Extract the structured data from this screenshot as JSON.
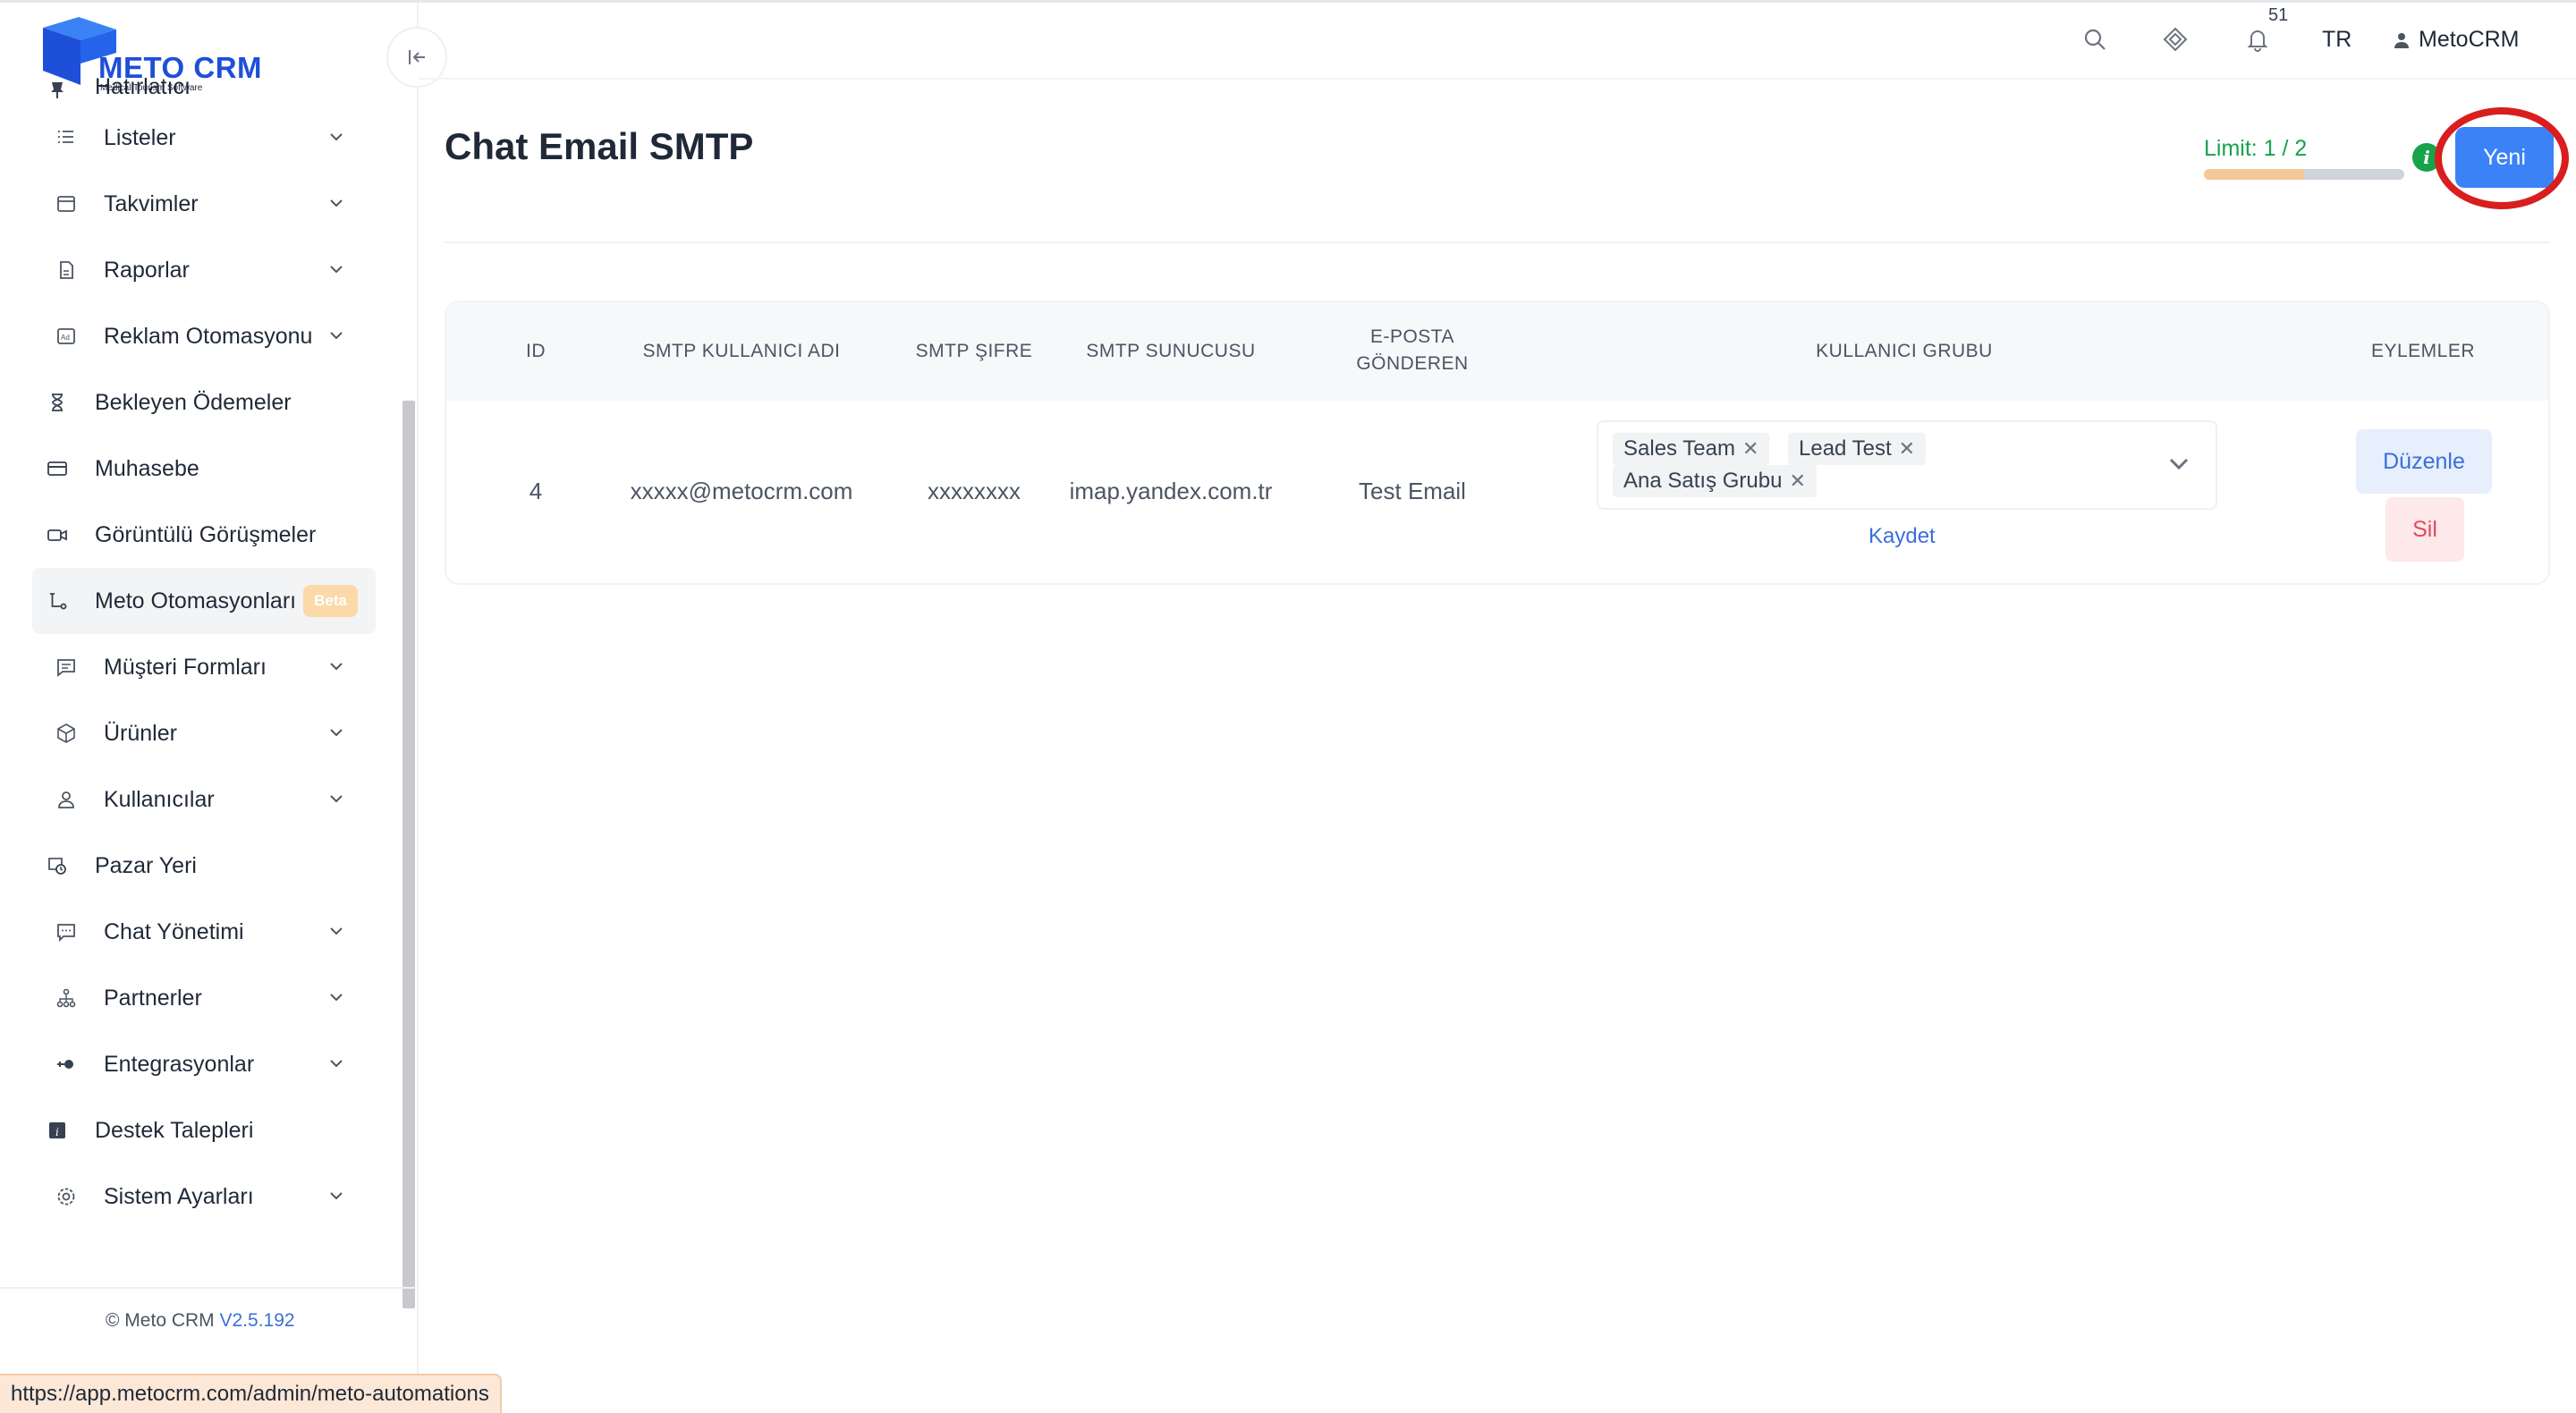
{
  "brand": {
    "name": "METO CRM",
    "tagline": "Medical Tourism Software",
    "accent": "#1e4fd8"
  },
  "sidebar": {
    "partial_item": {
      "label": "Hatırlatıcı",
      "icon": "pin-icon"
    },
    "items": [
      {
        "label": "Listeler",
        "icon": "list-icon",
        "expandable": true
      },
      {
        "label": "Takvimler",
        "icon": "calendar-icon",
        "expandable": true
      },
      {
        "label": "Raporlar",
        "icon": "report-icon",
        "expandable": true
      },
      {
        "label": "Reklam Otomasyonu",
        "icon": "ad-icon",
        "expandable": true
      },
      {
        "label": "Bekleyen Ödemeler",
        "icon": "hourglass-icon",
        "expandable": false
      },
      {
        "label": "Muhasebe",
        "icon": "card-icon",
        "expandable": false
      },
      {
        "label": "Görüntülü Görüşmeler",
        "icon": "video-icon",
        "expandable": false
      },
      {
        "label": "Meto Otomasyonları",
        "icon": "flow-icon",
        "expandable": false,
        "badge": "Beta",
        "active": true
      },
      {
        "label": "Müşteri Formları",
        "icon": "form-icon",
        "expandable": true
      },
      {
        "label": "Ürünler",
        "icon": "box-icon",
        "expandable": true
      },
      {
        "label": "Kullanıcılar",
        "icon": "user-icon",
        "expandable": true
      },
      {
        "label": "Pazar Yeri",
        "icon": "marketplace-icon",
        "expandable": false
      },
      {
        "label": "Chat Yönetimi",
        "icon": "chat-icon",
        "expandable": true
      },
      {
        "label": "Partnerler",
        "icon": "network-icon",
        "expandable": true
      },
      {
        "label": "Entegrasyonlar",
        "icon": "plug-icon",
        "expandable": true
      },
      {
        "label": "Destek Talepleri",
        "icon": "info-square-icon",
        "expandable": false
      },
      {
        "label": "Sistem Ayarları",
        "icon": "gear-icon",
        "expandable": true
      }
    ],
    "footer": {
      "copyright": "© Meto CRM",
      "version": "V2.5.192"
    }
  },
  "topbar": {
    "notification_count": "51",
    "language": "TR",
    "user_name": "MetoCRM"
  },
  "page": {
    "title": "Chat Email SMTP",
    "limit_label": "Limit: 1 / 2",
    "limit_fraction": 0.5,
    "new_button": "Yeni"
  },
  "table": {
    "headers": {
      "id": "ID",
      "username": "SMTP KULLANICI ADI",
      "password": "SMTP ŞIFRE",
      "server": "SMTP SUNUCUSU",
      "sender_line1": "E-POSTA",
      "sender_line2": "GÖNDEREN",
      "group": "KULLANICI GRUBU",
      "actions": "EYLEMLER"
    },
    "rows": [
      {
        "id": "4",
        "username": "xxxxx@metocrm.com",
        "password": "xxxxxxxx",
        "server": "imap.yandex.com.tr",
        "sender": "Test Email",
        "groups": [
          "Sales Team",
          "Lead Test",
          "Ana Satış Grubu"
        ],
        "save_label": "Kaydet",
        "edit_label": "Düzenle",
        "delete_label": "Sil"
      }
    ]
  },
  "status_bar": {
    "url": "https://app.metocrm.com/admin/meto-automations"
  }
}
